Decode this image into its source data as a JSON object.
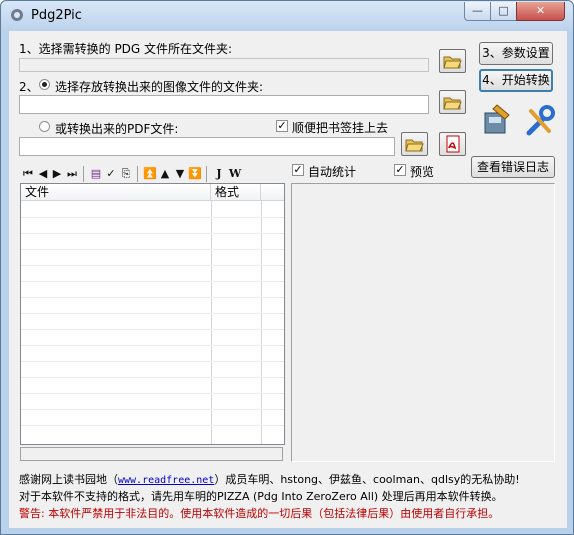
{
  "window": {
    "title": "Pdg2Pic",
    "min": "—",
    "max": "□",
    "close": "✕"
  },
  "step1": {
    "label": "1、选择需转换的 PDG 文件所在文件夹:",
    "path": ""
  },
  "step2": {
    "label": "2、⊙ 选择存放转换出来的图像文件的文件夹:",
    "label_text": "选择存放转换出来的图像文件的文件夹:",
    "path": ""
  },
  "pdf": {
    "label": "或转换出来的PDF文件:",
    "path": "",
    "bookmark_label": "顺便把书签挂上去",
    "bookmark_checked": true
  },
  "buttons": {
    "settings": "3、参数设置",
    "start": "4、开始转换",
    "error_log": "查看错误日志"
  },
  "options": {
    "auto_stats": "自动统计",
    "preview": "预览"
  },
  "list": {
    "columns": [
      "文件",
      "格式"
    ]
  },
  "toolbar": {
    "icons": [
      "first-icon",
      "prev-icon",
      "next-icon",
      "last-icon",
      "page-icon",
      "check-icon",
      "export-icon",
      "top-icon",
      "up-icon",
      "down-icon",
      "bottom-icon",
      "j-icon",
      "w-icon"
    ],
    "j_text": "J",
    "w_text": "W"
  },
  "footer": {
    "line1_pre": "感谢网上读书园地（",
    "line1_link": "www.readfree.net",
    "line1_post": "）成员车明、hstong、伊兹鱼、coolman、qdlsy的无私协助!",
    "line2": "对于本软件不支持的格式，请先用车明的PIZZA (Pdg Into ZeroZero All) 处理后再用本软件转换。",
    "line3": "警告: 本软件严禁用于非法目的。使用本软件造成的一切后果（包括法律后果）由使用者自行承担。"
  },
  "colors": {
    "warning": "#c00000",
    "link": "#0000cc",
    "selection": "#3c7fb1"
  }
}
